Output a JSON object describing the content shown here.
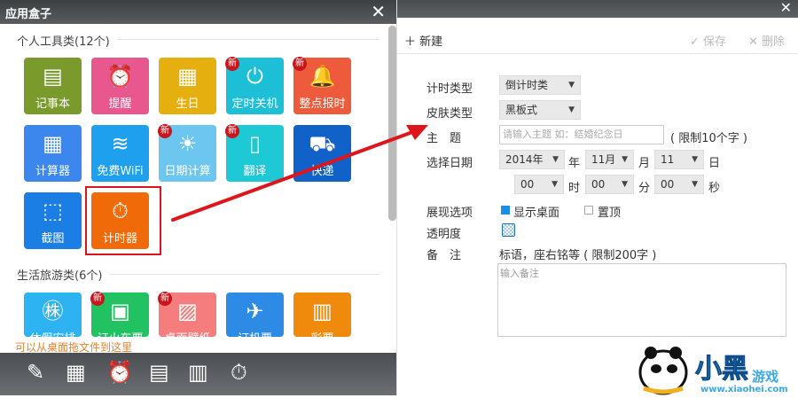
{
  "left": {
    "title": "应用盒子",
    "close": "✕",
    "section1": "个人工具类(12个)",
    "section2": "生活旅游类(6个)",
    "badge": "新",
    "tiles1": [
      {
        "label": "记事本",
        "icon": "▤",
        "color": "#7a9a2c",
        "new": false
      },
      {
        "label": "提醒",
        "icon": "⏰",
        "color": "#e9578f",
        "new": false
      },
      {
        "label": "生日",
        "icon": "▦",
        "color": "#e5b00f",
        "new": false
      },
      {
        "label": "定时关机",
        "icon": "⏻",
        "color": "#1cbfd6",
        "new": true
      },
      {
        "label": "整点报时",
        "icon": "🔔",
        "color": "#ee5a3c",
        "new": true
      },
      {
        "label": "计算器",
        "icon": "▦",
        "color": "#3b87ee",
        "new": false
      },
      {
        "label": "免费WiFi",
        "icon": "≋",
        "color": "#1fa0ef",
        "new": false
      },
      {
        "label": "日期计算",
        "icon": "☀",
        "color": "#6cc6f0",
        "new": true
      },
      {
        "label": "翻译",
        "icon": "▯",
        "color": "#1ec8d4",
        "new": true
      },
      {
        "label": "快递",
        "icon": "⛟",
        "color": "#1062c9",
        "new": false
      },
      {
        "label": "截图",
        "icon": "⬚",
        "color": "#1b7ee5",
        "new": false
      },
      {
        "label": "计时器",
        "icon": "⏱",
        "color": "#f06a09",
        "new": false
      }
    ],
    "tiles2": [
      {
        "label": "休假安排",
        "icon": "㊑",
        "color": "#2eb3f2",
        "new": false
      },
      {
        "label": "订火车票",
        "icon": "▣",
        "color": "#22c263",
        "new": true
      },
      {
        "label": "桌面壁纸",
        "icon": "▨",
        "color": "#f67d7d",
        "new": true
      },
      {
        "label": "订机票",
        "icon": "✈",
        "color": "#2d8be6",
        "new": false
      },
      {
        "label": "彩票",
        "icon": "▥",
        "color": "#f08a0c",
        "new": false
      }
    ],
    "hint": "可以从桌面拖文件到这里",
    "dock": [
      "✎",
      "▦",
      "⏰",
      "▤",
      "▥",
      "⏱"
    ]
  },
  "right": {
    "close": "✕",
    "new_btn": "＋ 新建",
    "save_btn": "✓ 保存",
    "delete_btn": "✕ 删除",
    "labels": {
      "timer_type": "计时类型",
      "skin_type": "皮肤类型",
      "topic": "主　题",
      "date": "选择日期",
      "display": "展现选项",
      "opacity": "透明度",
      "notes": "备　注"
    },
    "timer_type": "倒计时类",
    "skin_type": "黑板式",
    "topic_placeholder": "请输入主题 如：结婚纪念日",
    "topic_limit": "( 限制10个字 )",
    "year": "2014年",
    "year_unit": "年",
    "month": "11月",
    "month_unit": "月",
    "day": "11",
    "day_unit": "日",
    "hour": "00",
    "hour_unit": "时",
    "minute": "00",
    "minute_unit": "分",
    "second": "00",
    "second_unit": "秒",
    "show_desktop": "显示桌面",
    "pin_top": "置顶",
    "notes_hint": "标语，座右铭等 ( 限制200字 )",
    "notes_placeholder": "输入备注"
  },
  "watermark": {
    "text": "小黑游戏",
    "url": "www.xiaohei.com"
  },
  "colors": {
    "arrow": "#e0141b",
    "checkbox": "#1a8fe6"
  }
}
